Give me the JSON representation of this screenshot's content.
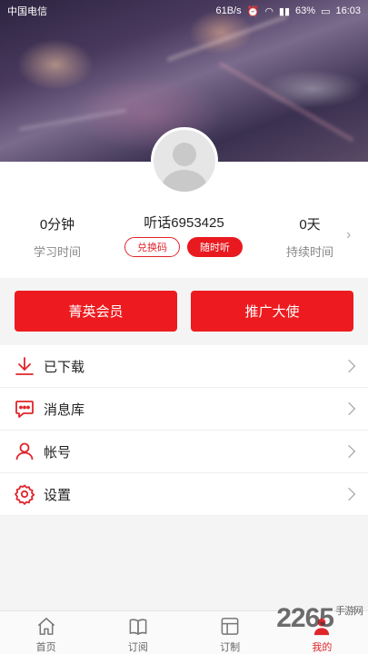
{
  "status_bar": {
    "carrier": "中国电信",
    "net_speed": "61B/s",
    "battery": "63%",
    "time": "16:03"
  },
  "profile": {
    "username": "听话6953425",
    "study_time_value": "0分钟",
    "study_time_label": "学习时间",
    "streak_value": "0天",
    "streak_label": "持续时间",
    "redeem_label": "兑换码",
    "listen_label": "随时听"
  },
  "actions": {
    "vip_label": "菁英会员",
    "ambassador_label": "推广大使"
  },
  "menu": [
    {
      "label": "已下载",
      "icon": "download-icon"
    },
    {
      "label": "消息库",
      "icon": "message-icon"
    },
    {
      "label": "帐号",
      "icon": "account-icon"
    },
    {
      "label": "设置",
      "icon": "settings-icon"
    }
  ],
  "tabs": [
    {
      "label": "首页",
      "icon": "home-icon"
    },
    {
      "label": "订阅",
      "icon": "book-icon"
    },
    {
      "label": "订制",
      "icon": "customize-icon"
    },
    {
      "label": "我的",
      "icon": "profile-icon"
    }
  ],
  "watermark": {
    "text": "2265",
    "sub": "手游网"
  },
  "colors": {
    "accent": "#e8191f",
    "text": "#222222",
    "muted": "#888888"
  }
}
